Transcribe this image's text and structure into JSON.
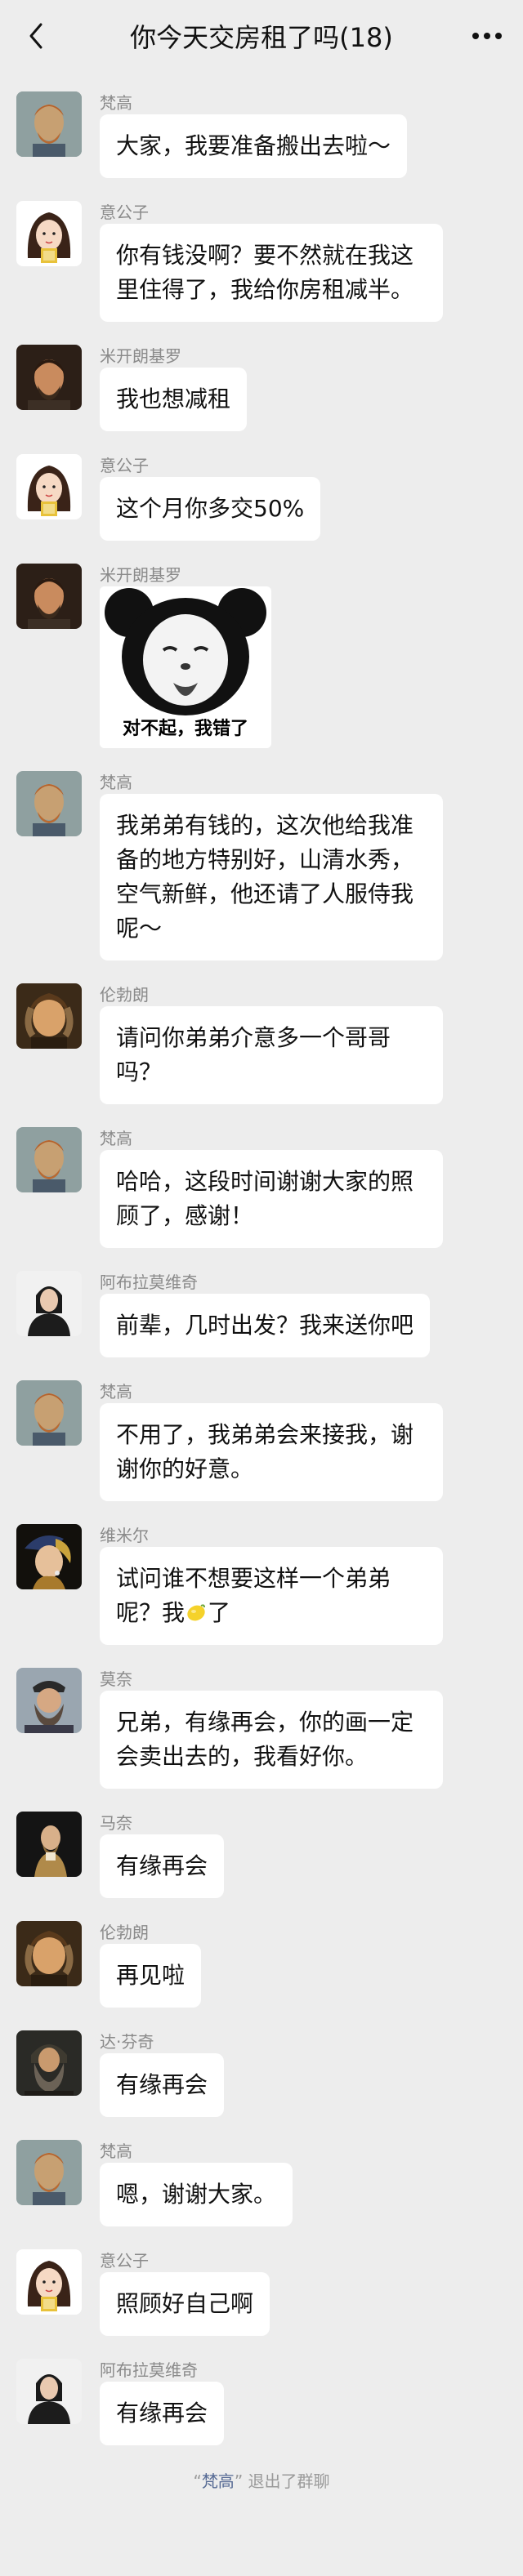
{
  "header": {
    "title": "你今天交房租了吗(18)"
  },
  "messages": [
    {
      "name": "梵高",
      "text": "大家，我要准备搬出去啦～",
      "avatar": "vangogh"
    },
    {
      "name": "意公子",
      "text": "你有钱没啊？要不然就在我这里住得了，我给你房租减半。",
      "avatar": "yigongzi"
    },
    {
      "name": "米开朗基罗",
      "text": "我也想减租",
      "avatar": "michelangelo"
    },
    {
      "name": "意公子",
      "text": "这个月你多交50%",
      "avatar": "yigongzi"
    },
    {
      "name": "米开朗基罗",
      "sticker_caption": "对不起，我错了",
      "avatar": "michelangelo"
    },
    {
      "name": "梵高",
      "text": "我弟弟有钱的，这次他给我准备的地方特别好，山清水秀，空气新鲜，他还请了人服侍我呢～",
      "avatar": "vangogh"
    },
    {
      "name": "伦勃朗",
      "text": "请问你弟弟介意多一个哥哥吗？",
      "avatar": "rembrandt"
    },
    {
      "name": "梵高",
      "text": "哈哈，这段时间谢谢大家的照顾了，感谢！",
      "avatar": "vangogh"
    },
    {
      "name": "阿布拉莫维奇",
      "text": "前辈，几时出发？我来送你吧",
      "avatar": "abramovic"
    },
    {
      "name": "梵高",
      "text": "不用了，我弟弟会来接我，谢谢你的好意。",
      "avatar": "vangogh"
    },
    {
      "name": "维米尔",
      "text_before": "试问谁不想要这样一个弟弟呢？我",
      "text_after": "了",
      "emoji": "lemon-icon",
      "avatar": "vermeer"
    },
    {
      "name": "莫奈",
      "text": "兄弟，有缘再会，你的画一定会卖出去的，我看好你。",
      "avatar": "monet"
    },
    {
      "name": "马奈",
      "text": "有缘再会",
      "avatar": "manet"
    },
    {
      "name": "伦勃朗",
      "text": "再见啦",
      "avatar": "rembrandt"
    },
    {
      "name": "达·芬奇",
      "text": "有缘再会",
      "avatar": "davinci"
    },
    {
      "name": "梵高",
      "text": "嗯，谢谢大家。",
      "avatar": "vangogh"
    },
    {
      "name": "意公子",
      "text": "照顾好自己啊",
      "avatar": "yigongzi"
    },
    {
      "name": "阿布拉莫维奇",
      "text": "有缘再会",
      "avatar": "abramovic"
    }
  ],
  "system_notice": {
    "quote_open": "“",
    "who": "梵高",
    "quote_close": "”",
    "text": " 退出了群聊"
  }
}
